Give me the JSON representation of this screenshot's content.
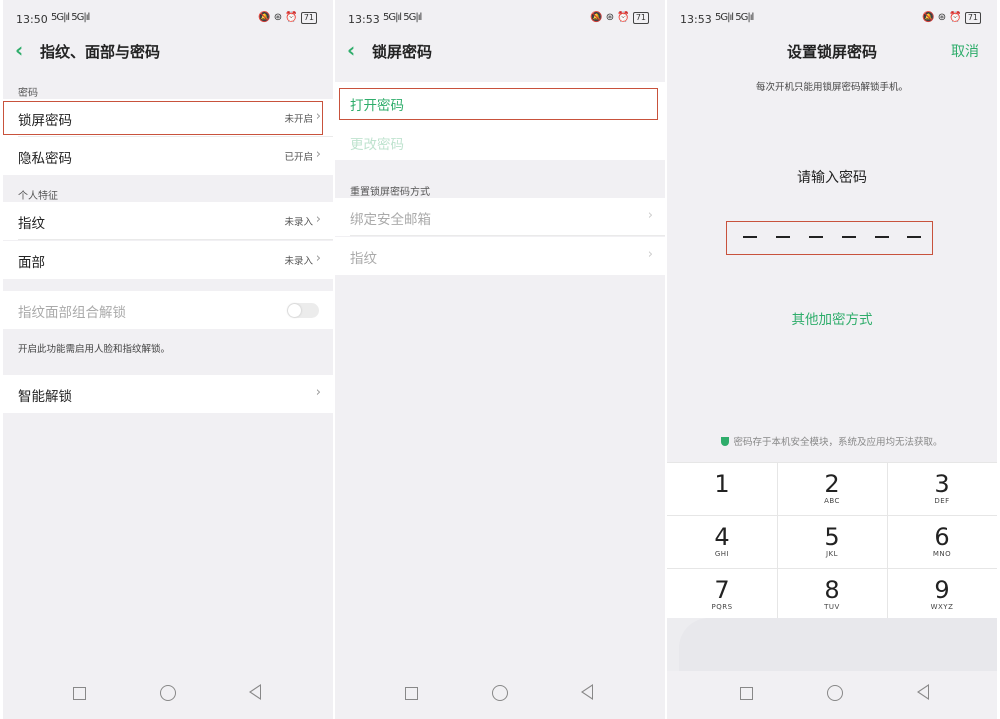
{
  "panel1": {
    "status": {
      "time": "13:50",
      "signal": "5G|ıl 5G|ıl",
      "battery": "71"
    },
    "title": "指纹、面部与密码",
    "section_password": "密码",
    "lock_password": {
      "label": "锁屏密码",
      "value": "未开启"
    },
    "private_password": {
      "label": "隐私密码",
      "value": "已开启"
    },
    "section_personal": "个人特征",
    "fingerprint": {
      "label": "指纹",
      "value": "未录入"
    },
    "face": {
      "label": "面部",
      "value": "未录入"
    },
    "combo_unlock": {
      "label": "指纹面部组合解锁"
    },
    "combo_note": "开启此功能需启用人脸和指纹解锁。",
    "smart_unlock": {
      "label": "智能解锁"
    }
  },
  "panel2": {
    "status": {
      "time": "13:53",
      "signal": "5G|ıl 5G|ıl",
      "battery": "71"
    },
    "title": "锁屏密码",
    "open_password": "打开密码",
    "change_password": "更改密码",
    "section_reset": "重置锁屏密码方式",
    "bind_email": "绑定安全邮箱",
    "fingerprint": "指纹"
  },
  "panel3": {
    "status": {
      "time": "13:53",
      "signal": "5G|ıl 5G|ıl",
      "battery": "71"
    },
    "title": "设置锁屏密码",
    "cancel": "取消",
    "subtext": "每次开机只能用锁屏密码解锁手机。",
    "prompt": "请输入密码",
    "other_methods": "其他加密方式",
    "secure_note": "密码存于本机安全模块，系统及应用均无法获取。",
    "keys": [
      {
        "digit": "1",
        "letters": ""
      },
      {
        "digit": "2",
        "letters": "ABC"
      },
      {
        "digit": "3",
        "letters": "DEF"
      },
      {
        "digit": "4",
        "letters": "GHI"
      },
      {
        "digit": "5",
        "letters": "JKL"
      },
      {
        "digit": "6",
        "letters": "MNO"
      },
      {
        "digit": "7",
        "letters": "PQRS"
      },
      {
        "digit": "8",
        "letters": "TUV"
      },
      {
        "digit": "9",
        "letters": "WXYZ"
      }
    ]
  },
  "colors": {
    "accent": "#2fad6b",
    "highlight": "#c8523c",
    "background": "#f1f0f3"
  }
}
